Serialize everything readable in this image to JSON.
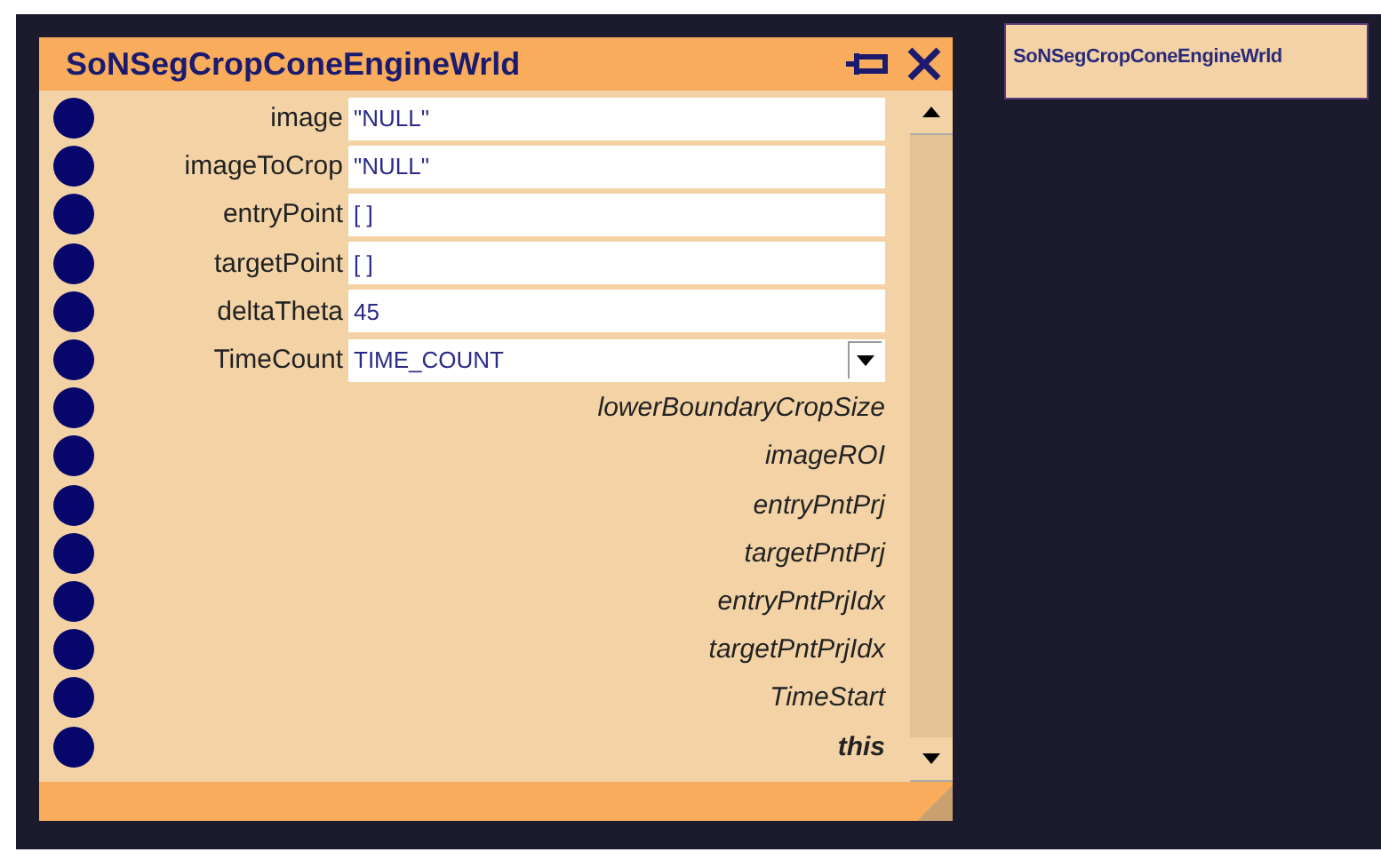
{
  "node": {
    "title": "SoNSegCropConeEngineWrld",
    "ports": [
      {
        "kind": "input",
        "label": "image",
        "value": "\"NULL\""
      },
      {
        "kind": "input",
        "label": "imageToCrop",
        "value": "\"NULL\""
      },
      {
        "kind": "input",
        "label": "entryPoint",
        "value": "[ ]"
      },
      {
        "kind": "input",
        "label": "targetPoint",
        "value": "[ ]"
      },
      {
        "kind": "input",
        "label": "deltaTheta",
        "value": "45"
      },
      {
        "kind": "select",
        "label": "TimeCount",
        "value": "TIME_COUNT"
      },
      {
        "kind": "output",
        "label": "lowerBoundaryCropSize"
      },
      {
        "kind": "output",
        "label": "imageROI"
      },
      {
        "kind": "output",
        "label": "entryPntPrj"
      },
      {
        "kind": "output",
        "label": "targetPntPrj"
      },
      {
        "kind": "output",
        "label": "entryPntPrjIdx"
      },
      {
        "kind": "output",
        "label": "targetPntPrjIdx"
      },
      {
        "kind": "output",
        "label": "TimeStart"
      },
      {
        "kind": "self",
        "label": "this"
      }
    ]
  },
  "minimap": {
    "title": "SoNSegCropConeEngineWrld"
  }
}
